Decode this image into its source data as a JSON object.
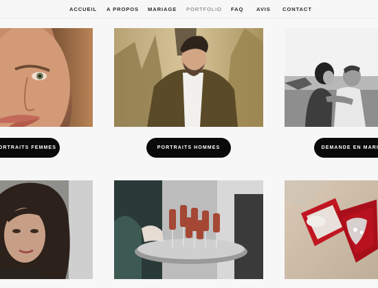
{
  "nav": {
    "items": [
      {
        "label": "ACCUEIL"
      },
      {
        "label": "A PROPOS"
      },
      {
        "label": "MARIAGE"
      },
      {
        "label": "PORTFOLIO",
        "active": true
      },
      {
        "label": "FAQ"
      },
      {
        "label": "AVIS"
      },
      {
        "label": "CONTACT"
      }
    ]
  },
  "gallery": {
    "row1": [
      {
        "image": "portrait-woman-freckles",
        "button_label": "PORTRAITS FEMMES"
      },
      {
        "image": "portrait-man-grass",
        "button_label": "PORTRAITS HOMMES"
      },
      {
        "image": "couple-kiss-bw",
        "button_label": "DEMANDE EN MARIAGE"
      }
    ],
    "row2": [
      {
        "image": "portrait-woman-dark-hair"
      },
      {
        "image": "champagne-tray"
      },
      {
        "image": "ring-box-red"
      }
    ]
  },
  "colors": {
    "background": "#f7f7f7",
    "button_bg": "#0a0a0a",
    "button_text": "#ffffff",
    "nav_text": "#2a2a2a",
    "nav_active": "#6f6f6f"
  }
}
